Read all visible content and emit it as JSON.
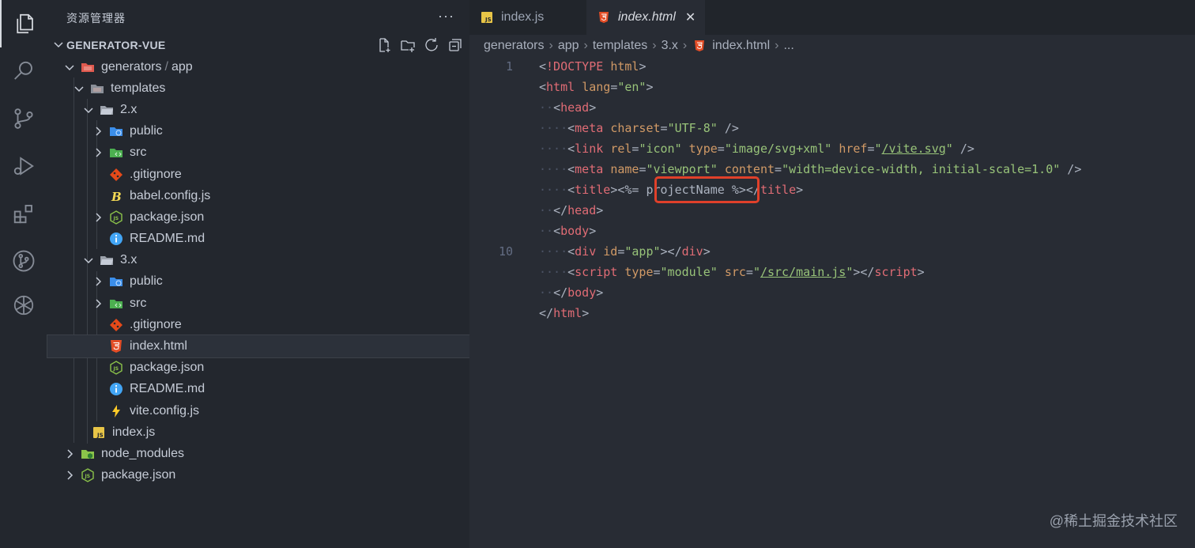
{
  "activity_bar": {
    "items": [
      {
        "icon": "files-icon",
        "active": true
      },
      {
        "icon": "search-icon"
      },
      {
        "icon": "source-control-icon"
      },
      {
        "icon": "run-debug-icon"
      },
      {
        "icon": "extensions-icon"
      },
      {
        "icon": "git-graph-icon"
      },
      {
        "icon": "openai-icon"
      }
    ]
  },
  "sidebar": {
    "title": "资源管理器",
    "more": "···",
    "project": "GENERATOR-VUE",
    "tree": [
      {
        "label": "generators",
        "label2": "app",
        "depth": 0,
        "type": "folder-open",
        "icon": "folder-open-red-icon"
      },
      {
        "label": "templates",
        "depth": 1,
        "type": "folder-open",
        "icon": "folder-open-icon"
      },
      {
        "label": "2.x",
        "depth": 2,
        "type": "folder-open",
        "icon": "folder-open-plain-icon"
      },
      {
        "label": "public",
        "depth": 3,
        "type": "folder",
        "icon": "folder-public-icon"
      },
      {
        "label": "src",
        "depth": 3,
        "type": "folder",
        "icon": "folder-src-icon"
      },
      {
        "label": ".gitignore",
        "depth": 3,
        "type": "file",
        "icon": "git-icon"
      },
      {
        "label": "babel.config.js",
        "depth": 3,
        "type": "file",
        "icon": "babel-icon"
      },
      {
        "label": "package.json",
        "depth": 3,
        "type": "folder",
        "icon": "nodejs-icon"
      },
      {
        "label": "README.md",
        "depth": 3,
        "type": "file",
        "icon": "info-icon"
      },
      {
        "label": "3.x",
        "depth": 2,
        "type": "folder-open",
        "icon": "folder-open-plain-icon"
      },
      {
        "label": "public",
        "depth": 3,
        "type": "folder",
        "icon": "folder-public-icon"
      },
      {
        "label": "src",
        "depth": 3,
        "type": "folder",
        "icon": "folder-src-icon"
      },
      {
        "label": ".gitignore",
        "depth": 3,
        "type": "file",
        "icon": "git-icon"
      },
      {
        "label": "index.html",
        "depth": 3,
        "type": "file",
        "icon": "html-icon",
        "selected": true
      },
      {
        "label": "package.json",
        "depth": 3,
        "type": "file",
        "icon": "nodejs-icon"
      },
      {
        "label": "README.md",
        "depth": 3,
        "type": "file",
        "icon": "info-icon"
      },
      {
        "label": "vite.config.js",
        "depth": 3,
        "type": "file",
        "icon": "vite-icon"
      },
      {
        "label": "index.js",
        "depth": 2,
        "type": "file",
        "icon": "js-icon"
      },
      {
        "label": "node_modules",
        "depth": 0,
        "type": "folder",
        "icon": "folder-node-icon"
      },
      {
        "label": "package.json",
        "depth": 0,
        "type": "folder",
        "icon": "nodejs-icon"
      }
    ]
  },
  "tabs": [
    {
      "label": "index.js",
      "icon": "js-icon",
      "active": false
    },
    {
      "label": "index.html",
      "icon": "html-icon",
      "active": true,
      "close": "✕"
    }
  ],
  "breadcrumbs": [
    "generators",
    "app",
    "templates",
    "3.x",
    "index.html",
    "..."
  ],
  "code": {
    "line_numbers": {
      "1": "1",
      "10": "10"
    },
    "highlight_text": "projectName"
  },
  "watermark": "@稀土掘金技术社区",
  "colors": {
    "highlight_border": "#e0402a",
    "tag": "#e06c75",
    "attr": "#d19a66",
    "string": "#98c379"
  }
}
